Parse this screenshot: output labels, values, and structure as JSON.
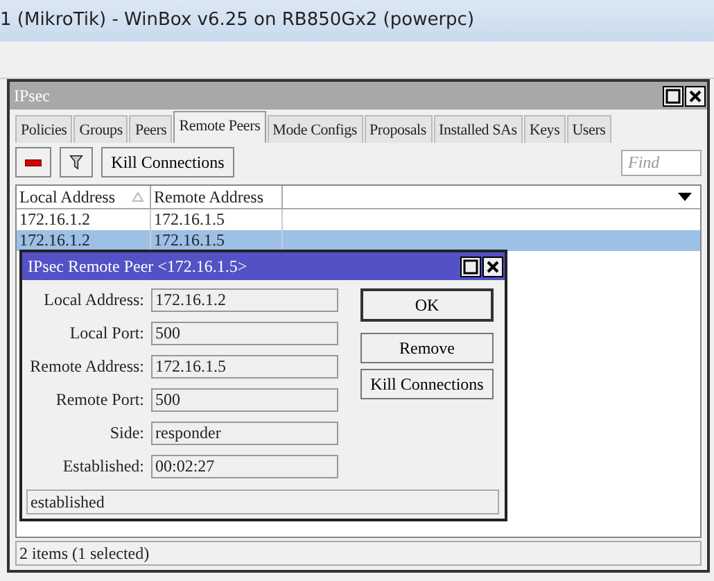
{
  "app_title": "1 (MikroTik) - WinBox v6.25 on RB850Gx2 (powerpc)",
  "window": {
    "title": "IPsec"
  },
  "tabs": [
    {
      "label": "Policies",
      "selected": false
    },
    {
      "label": "Groups",
      "selected": false
    },
    {
      "label": "Peers",
      "selected": false
    },
    {
      "label": "Remote Peers",
      "selected": true
    },
    {
      "label": "Mode Configs",
      "selected": false
    },
    {
      "label": "Proposals",
      "selected": false
    },
    {
      "label": "Installed SAs",
      "selected": false
    },
    {
      "label": "Keys",
      "selected": false
    },
    {
      "label": "Users",
      "selected": false
    }
  ],
  "toolbar": {
    "buttons": [
      {
        "kind": "remove"
      },
      {
        "kind": "filter"
      },
      {
        "kind": "text",
        "label": "Kill Connections"
      }
    ],
    "search": {
      "placeholder": "Find"
    }
  },
  "table": {
    "columns": [
      {
        "label": "Local Address",
        "sorted": true
      },
      {
        "label": "Remote Address",
        "sorted": false
      }
    ],
    "rows": [
      {
        "cells": [
          "172.16.1.2",
          "172.16.1.5"
        ],
        "selected": false
      },
      {
        "cells": [
          "172.16.1.2",
          "172.16.1.5"
        ],
        "selected": true
      }
    ]
  },
  "dialog": {
    "title": "IPsec Remote Peer <172.16.1.5>",
    "fields": [
      {
        "label": "Local Address:",
        "value": "172.16.1.2"
      },
      {
        "label": "Local Port:",
        "value": "500"
      },
      {
        "label": "Remote Address:",
        "value": "172.16.1.5"
      },
      {
        "label": "Remote Port:",
        "value": "500"
      },
      {
        "label": "Side:",
        "value": "responder"
      },
      {
        "label": "Established:",
        "value": "00:02:27"
      }
    ],
    "buttons": [
      {
        "label": "OK",
        "default": true
      },
      {
        "label": "Remove",
        "default": false
      },
      {
        "label": "Kill Connections",
        "default": false
      }
    ],
    "status": "established"
  },
  "status_bar": "2 items (1 selected)"
}
